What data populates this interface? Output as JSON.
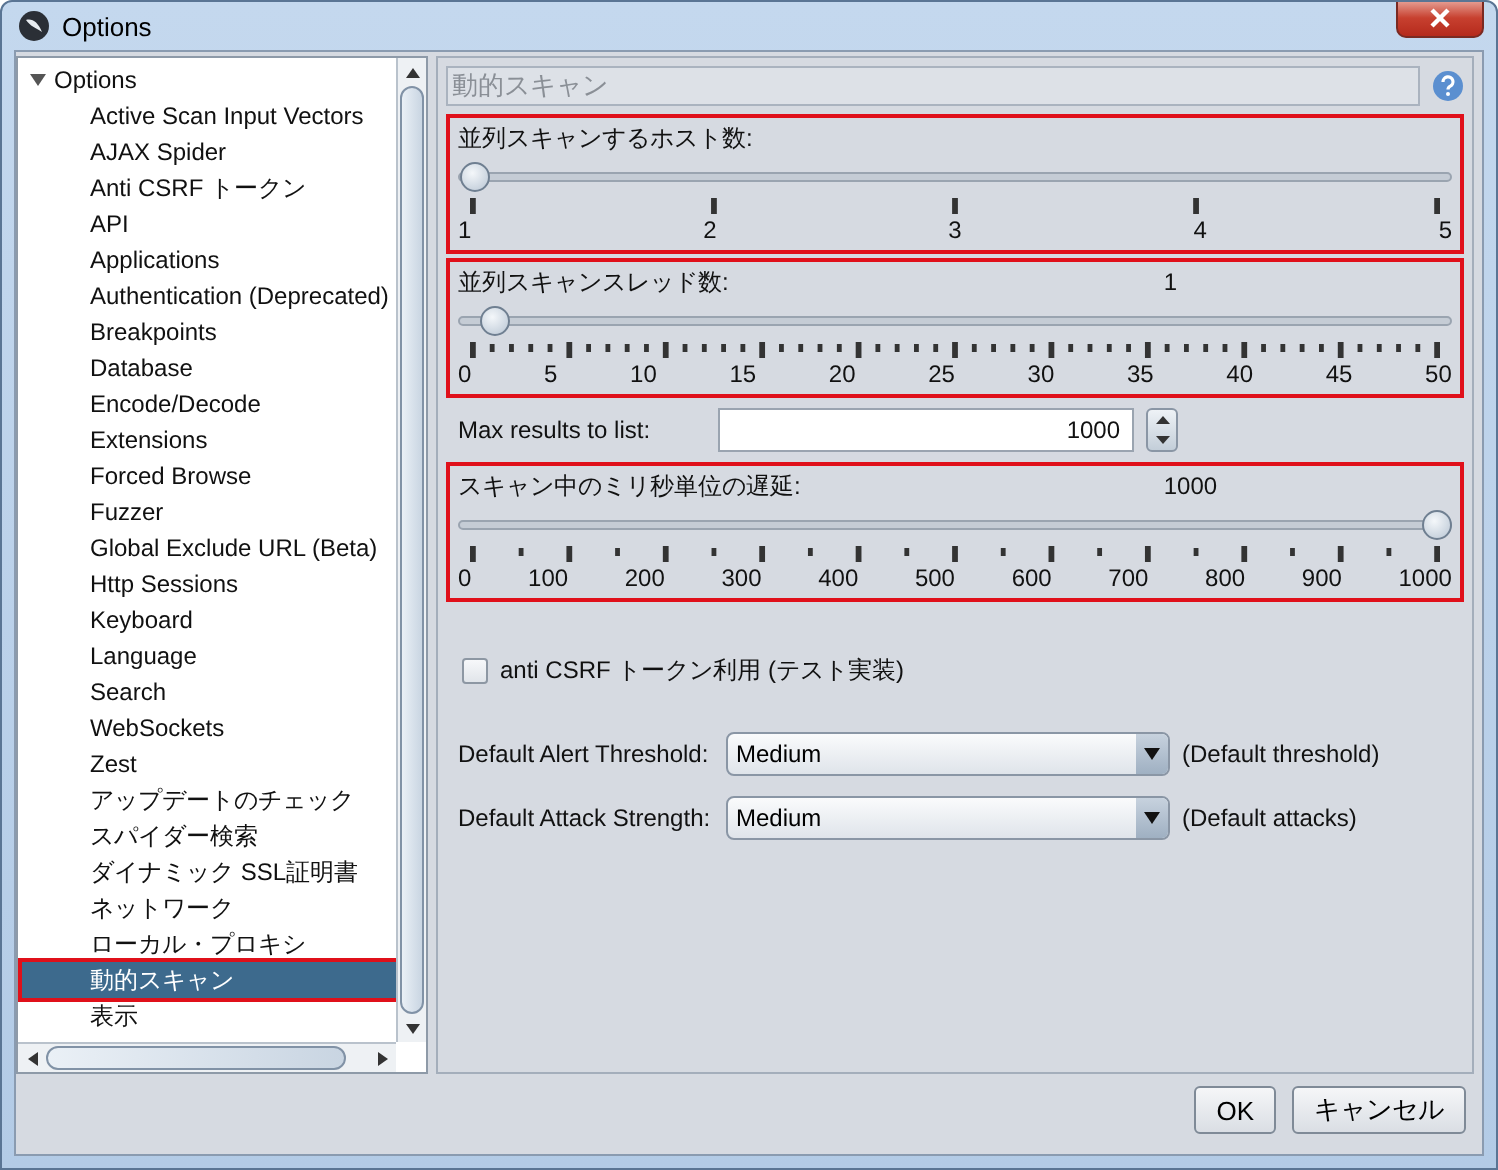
{
  "window": {
    "title": "Options"
  },
  "tree": {
    "root": {
      "label": "Options",
      "expanded": true
    },
    "items": [
      {
        "label": "Active Scan Input Vectors",
        "selected": false,
        "highlighted": false
      },
      {
        "label": "AJAX Spider",
        "selected": false,
        "highlighted": false
      },
      {
        "label": "Anti CSRF トークン",
        "selected": false,
        "highlighted": false
      },
      {
        "label": "API",
        "selected": false,
        "highlighted": false
      },
      {
        "label": "Applications",
        "selected": false,
        "highlighted": false
      },
      {
        "label": "Authentication (Deprecated)",
        "selected": false,
        "highlighted": false
      },
      {
        "label": "Breakpoints",
        "selected": false,
        "highlighted": false
      },
      {
        "label": "Database",
        "selected": false,
        "highlighted": false
      },
      {
        "label": "Encode/Decode",
        "selected": false,
        "highlighted": false
      },
      {
        "label": "Extensions",
        "selected": false,
        "highlighted": false
      },
      {
        "label": "Forced Browse",
        "selected": false,
        "highlighted": false
      },
      {
        "label": "Fuzzer",
        "selected": false,
        "highlighted": false
      },
      {
        "label": "Global Exclude URL (Beta)",
        "selected": false,
        "highlighted": false
      },
      {
        "label": "Http Sessions",
        "selected": false,
        "highlighted": false
      },
      {
        "label": "Keyboard",
        "selected": false,
        "highlighted": false
      },
      {
        "label": "Language",
        "selected": false,
        "highlighted": false
      },
      {
        "label": "Search",
        "selected": false,
        "highlighted": false
      },
      {
        "label": "WebSockets",
        "selected": false,
        "highlighted": false
      },
      {
        "label": "Zest",
        "selected": false,
        "highlighted": false
      },
      {
        "label": "アップデートのチェック",
        "selected": false,
        "highlighted": false
      },
      {
        "label": "スパイダー検索",
        "selected": false,
        "highlighted": false
      },
      {
        "label": "ダイナミック SSL証明書",
        "selected": false,
        "highlighted": false
      },
      {
        "label": "ネットワーク",
        "selected": false,
        "highlighted": false
      },
      {
        "label": "ローカル・プロキシ",
        "selected": false,
        "highlighted": false
      },
      {
        "label": "動的スキャン",
        "selected": true,
        "highlighted": true
      },
      {
        "label": "表示",
        "selected": false,
        "highlighted": false
      }
    ]
  },
  "panel": {
    "title": "動的スキャン",
    "controls": [
      {
        "kind": "slider",
        "label": "並列スキャンするホスト数:",
        "level": 0,
        "ticks": [
          "1",
          "2",
          "3",
          "4",
          "5"
        ],
        "highlighted": true
      },
      {
        "kind": "slider-fives",
        "label": "並列スキャンスレッド数:",
        "value": "1",
        "level": 0.02,
        "ticks": [
          "0",
          "5",
          "10",
          "15",
          "20",
          "25",
          "30",
          "35",
          "40",
          "45",
          "50"
        ],
        "highlighted": true
      },
      {
        "kind": "spinner",
        "label": "Max results to list:",
        "value": "1000"
      },
      {
        "kind": "slider-halves",
        "label": "スキャン中のミリ秒単位の遅延:",
        "value": "1000",
        "level": 1,
        "ticks": [
          "0",
          "100",
          "200",
          "300",
          "400",
          "500",
          "600",
          "700",
          "800",
          "900",
          "1000"
        ],
        "highlighted": true
      },
      {
        "kind": "checkbox",
        "label": "anti CSRF トークン利用 (テスト実装)",
        "checked": false
      },
      {
        "kind": "combo",
        "label": "Default Alert Threshold:",
        "value": "Medium",
        "note": "(Default threshold)"
      },
      {
        "kind": "combo",
        "label": "Default Attack Strength:",
        "value": "Medium",
        "note": "(Default attacks)"
      }
    ]
  },
  "buttons": [
    {
      "label": "OK"
    },
    {
      "label": "キャンセル"
    }
  ]
}
